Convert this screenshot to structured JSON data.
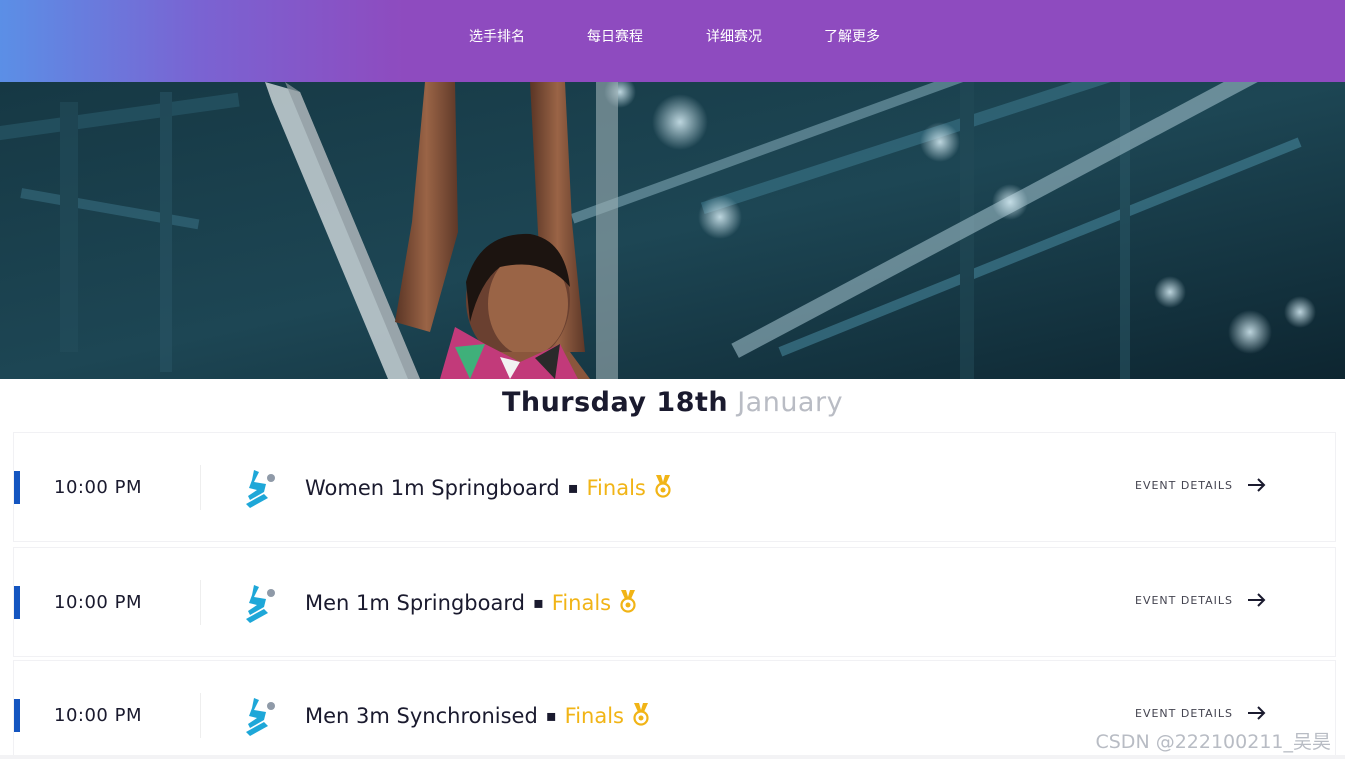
{
  "header": {
    "nav": [
      {
        "label": "选手排名"
      },
      {
        "label": "每日赛程"
      },
      {
        "label": "详细赛况"
      },
      {
        "label": "了解更多"
      }
    ],
    "gradient_colors": [
      "#5b8fe6",
      "#8e4bbf"
    ]
  },
  "hero": {
    "image": "diver-on-platform-photo"
  },
  "schedule": {
    "day": "Thursday 18th",
    "month": "January",
    "accent_color": "#1455c0",
    "stage_color": "#f1b416",
    "events": [
      {
        "time": "10:00 PM",
        "name": "Women 1m Springboard",
        "stage": "Finals",
        "details_label": "EVENT DETAILS",
        "icon": "diving-icon",
        "medal_icon": "medal-icon"
      },
      {
        "time": "10:00 PM",
        "name": "Men 1m Springboard",
        "stage": "Finals",
        "details_label": "EVENT DETAILS",
        "icon": "diving-icon",
        "medal_icon": "medal-icon"
      },
      {
        "time": "10:00 PM",
        "name": "Men 3m Synchronised",
        "stage": "Finals",
        "details_label": "EVENT DETAILS",
        "icon": "diving-icon",
        "medal_icon": "medal-icon"
      }
    ]
  },
  "watermark": "CSDN @222100211_吴昊"
}
